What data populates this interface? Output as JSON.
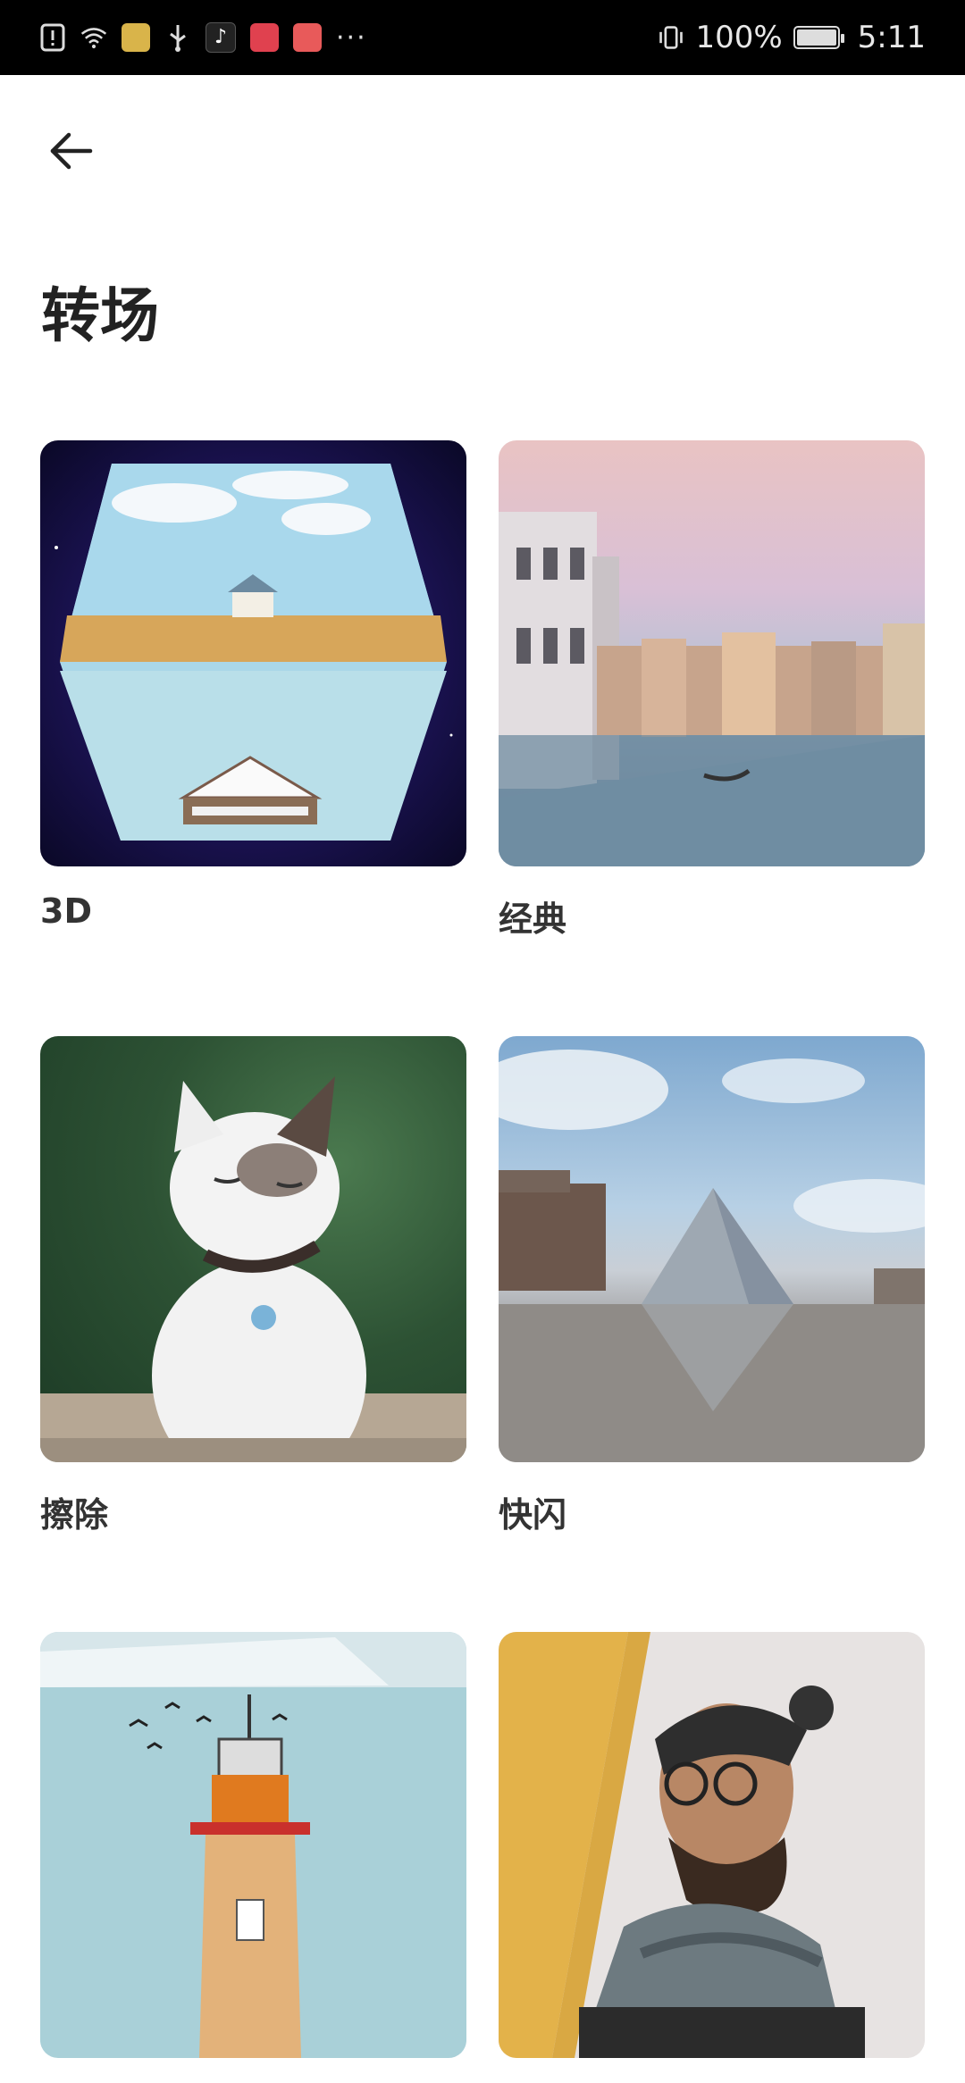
{
  "status_bar": {
    "battery_percent": "100%",
    "time": "5:11",
    "battery_level": 1.0,
    "left_icons": [
      "alert-icon",
      "wifi-icon",
      "taxi-app-icon",
      "usb-icon",
      "tiktok-app-icon",
      "shop-app-icon",
      "book-app-icon"
    ],
    "overflow": "···"
  },
  "header": {
    "back_icon": "arrow-left-icon",
    "title": "转场"
  },
  "items": [
    {
      "label": "3D"
    },
    {
      "label": "经典"
    },
    {
      "label": "擦除"
    },
    {
      "label": "快闪"
    },
    {
      "label": ""
    },
    {
      "label": ""
    }
  ]
}
